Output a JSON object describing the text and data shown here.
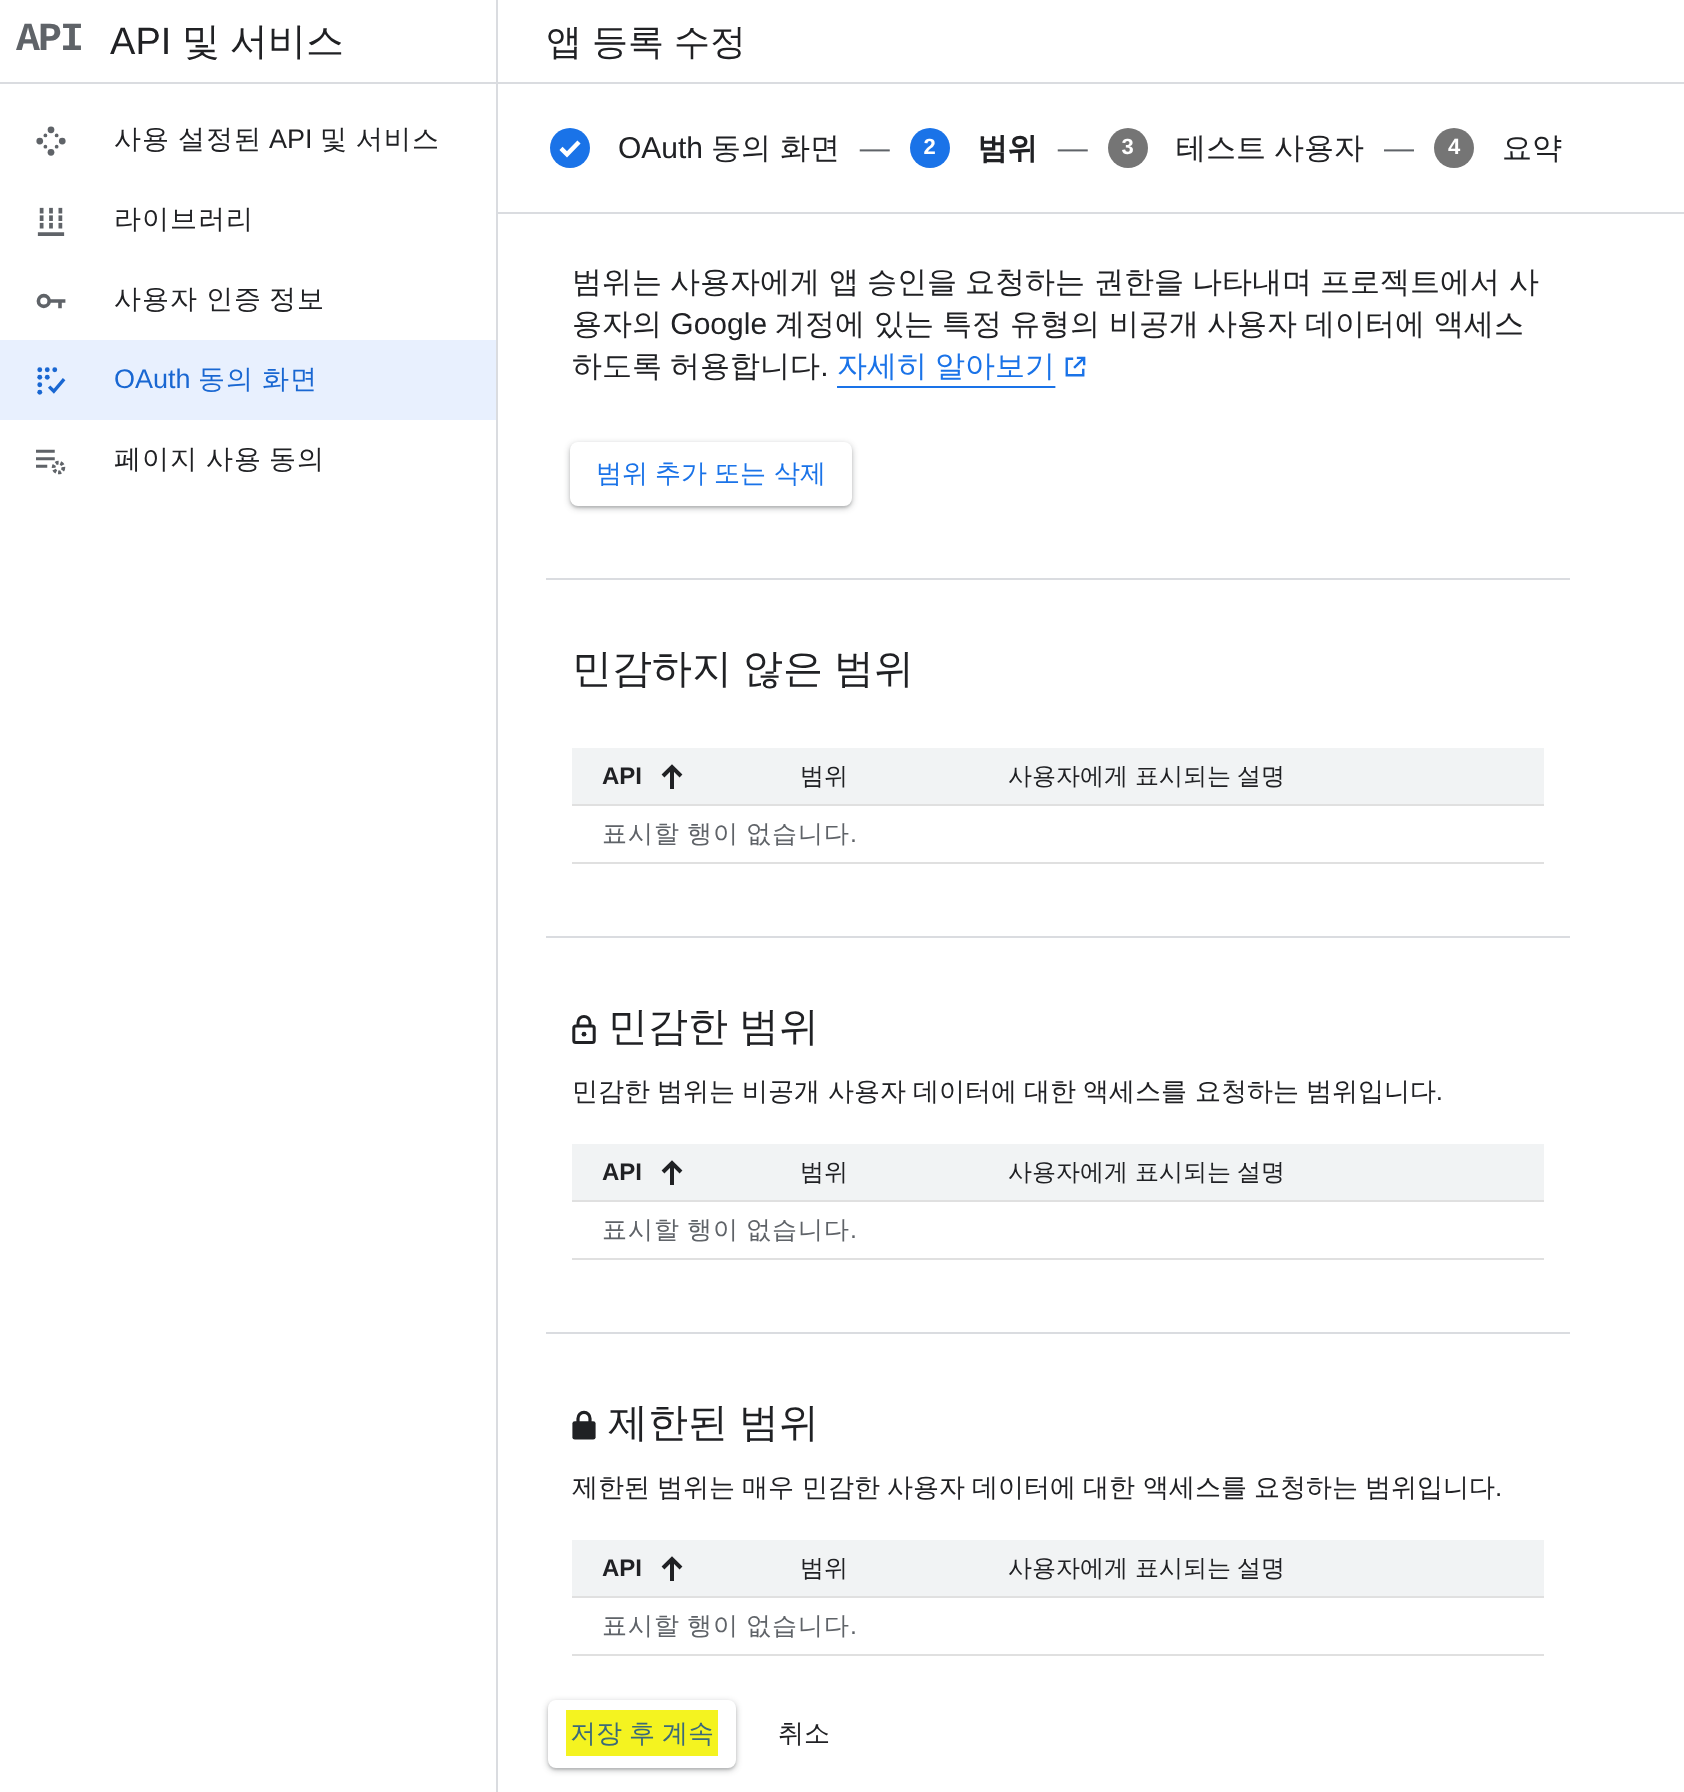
{
  "sidebar": {
    "logo": "API",
    "title": "API 및 서비스",
    "items": [
      {
        "kind": "enabled-apis",
        "label": "사용 설정된 API 및 서비스",
        "selected": false
      },
      {
        "kind": "library",
        "label": "라이브러리",
        "selected": false
      },
      {
        "kind": "credentials",
        "label": "사용자 인증 정보",
        "selected": false
      },
      {
        "kind": "oauth",
        "label": "OAuth 동의 화면",
        "selected": true
      },
      {
        "kind": "page-usage",
        "label": "페이지 사용 동의",
        "selected": false
      }
    ]
  },
  "header": {
    "title": "앱 등록 수정"
  },
  "stepper": {
    "steps": [
      {
        "label": "OAuth 동의 화면",
        "completed": true,
        "selected": false,
        "separator": "—"
      },
      {
        "number": "2",
        "label": "범위",
        "completed": false,
        "selected": true,
        "separator": "—"
      },
      {
        "number": "3",
        "label": "테스트 사용자",
        "completed": false,
        "selected": false,
        "separator": "—"
      },
      {
        "number": "4",
        "label": "요약",
        "completed": false,
        "selected": false
      }
    ]
  },
  "intro": {
    "text": "범위는 사용자에게 앱 승인을 요청하는 권한을 나타내며 프로젝트에서 사용자의 Google 계정에 있는 특정 유형의 비공개 사용자 데이터에 액세스하도록 허용합니다.",
    "link": "자세히 알아보기"
  },
  "add_button": "범위 추가 또는 삭제",
  "sections": [
    {
      "kind": "non-sensitive",
      "title": "민감하지 않은 범위",
      "table": {
        "columns": [
          {
            "label": "API",
            "sorted": true
          },
          {
            "label": "범위",
            "sorted": false
          },
          {
            "label": "사용자에게 표시되는 설명",
            "sorted": false
          }
        ],
        "empty_message": "표시할 행이 없습니다."
      }
    },
    {
      "kind": "sensitive",
      "title": "민감한 범위",
      "description": "민감한 범위는 비공개 사용자 데이터에 대한 액세스를 요청하는 범위입니다.",
      "table": {
        "columns": [
          {
            "label": "API",
            "sorted": true
          },
          {
            "label": "범위",
            "sorted": false
          },
          {
            "label": "사용자에게 표시되는 설명",
            "sorted": false
          }
        ],
        "empty_message": "표시할 행이 없습니다."
      }
    },
    {
      "kind": "restricted",
      "title": "제한된 범위",
      "description": "제한된 범위는 매우 민감한 사용자 데이터에 대한 액세스를 요청하는 범위입니다.",
      "table": {
        "columns": [
          {
            "label": "API",
            "sorted": true
          },
          {
            "label": "범위",
            "sorted": false
          },
          {
            "label": "사용자에게 표시되는 설명",
            "sorted": false
          }
        ],
        "empty_message": "표시할 행이 없습니다."
      }
    }
  ],
  "actions": [
    {
      "kind": "raised",
      "label": "저장 후 계속",
      "highlighted": true
    },
    {
      "kind": "flat",
      "label": "취소",
      "highlighted": false
    }
  ]
}
